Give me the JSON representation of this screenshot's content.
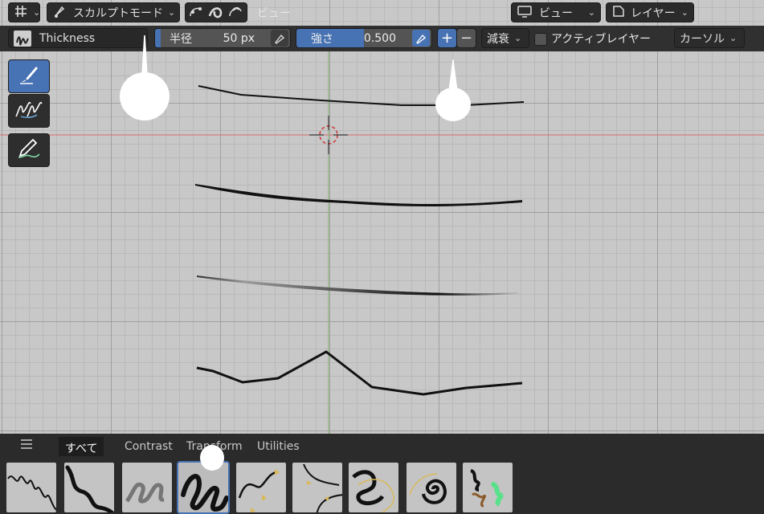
{
  "topbar": {
    "mode_label": "スカルプトモード",
    "view_menu_label": "ビュー",
    "view_dropdown_label": "ビュー",
    "layer_dropdown_label": "レイヤー"
  },
  "toolbar": {
    "brush_name": "Thickness",
    "radius_label": "半径",
    "radius_value": "50 px",
    "strength_label": "強さ",
    "strength_value": "0.500",
    "strength_level": 0.5,
    "plus_label": "+",
    "minus_label": "−",
    "falloff_label": "減衰",
    "active_layer_label": "アクティブレイヤー",
    "cursor_label": "カーソル"
  },
  "tools": {
    "items": [
      {
        "name": "tweak-tool",
        "icon": "brush-stroke-icon",
        "active": true
      },
      {
        "name": "smooth-tool",
        "icon": "strokes-icon",
        "active": false
      },
      {
        "name": "draw-tool",
        "icon": "pencil-icon",
        "active": false
      }
    ]
  },
  "shelf": {
    "menu_icon": "hamburger-icon",
    "tabs": [
      {
        "label": "すべて",
        "active": true
      },
      {
        "label": "Contrast",
        "active": false
      },
      {
        "label": "Transform",
        "active": false
      },
      {
        "label": "Utilities",
        "active": false
      }
    ],
    "brushes": [
      {
        "icon": "squiggle-icon",
        "selected": false
      },
      {
        "icon": "thick-wave-icon",
        "selected": false
      },
      {
        "icon": "soft-wave-icon",
        "selected": false
      },
      {
        "icon": "loop-icon",
        "selected": true
      },
      {
        "icon": "curve-arrows-icon",
        "selected": false
      },
      {
        "icon": "pinch-icon",
        "selected": false
      },
      {
        "icon": "twist-icon",
        "selected": false
      },
      {
        "icon": "spiral-icon",
        "selected": false
      },
      {
        "icon": "color-strokes-icon",
        "selected": false
      }
    ]
  },
  "colors": {
    "accent": "#4772b3",
    "header_bg": "#303030",
    "viewport_bg": "#c8c8c8"
  }
}
